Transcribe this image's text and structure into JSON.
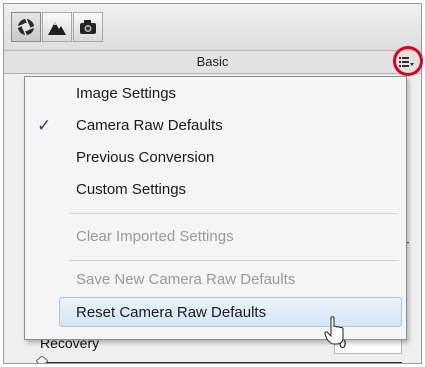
{
  "toolbar": {
    "tabs": [
      {
        "icon": "aperture-icon",
        "active": true
      },
      {
        "icon": "mountains-icon",
        "active": false
      },
      {
        "icon": "camera-icon",
        "active": false
      }
    ]
  },
  "panel": {
    "title": "Basic",
    "flyout_icon": "list-menu-icon"
  },
  "menu": {
    "items": [
      {
        "label": "Image Settings",
        "checked": false,
        "enabled": true
      },
      {
        "label": "Camera Raw Defaults",
        "checked": true,
        "enabled": true
      },
      {
        "label": "Previous Conversion",
        "checked": false,
        "enabled": true
      },
      {
        "label": "Custom Settings",
        "checked": false,
        "enabled": true
      },
      {
        "label": "Clear Imported Settings",
        "checked": false,
        "enabled": false
      },
      {
        "label": "Save New Camera Raw Defaults",
        "checked": false,
        "enabled": false
      },
      {
        "label": "Reset Camera Raw Defaults",
        "checked": false,
        "enabled": true,
        "highlighted": true
      }
    ],
    "check_glyph": "✓"
  },
  "controls": {
    "recovery_label": "Recovery",
    "recovery_value": "0"
  },
  "colors": {
    "highlight_ring": "#e0001b",
    "check_color": "#1b3f8c",
    "hover_bg": "#d4e6f6"
  }
}
